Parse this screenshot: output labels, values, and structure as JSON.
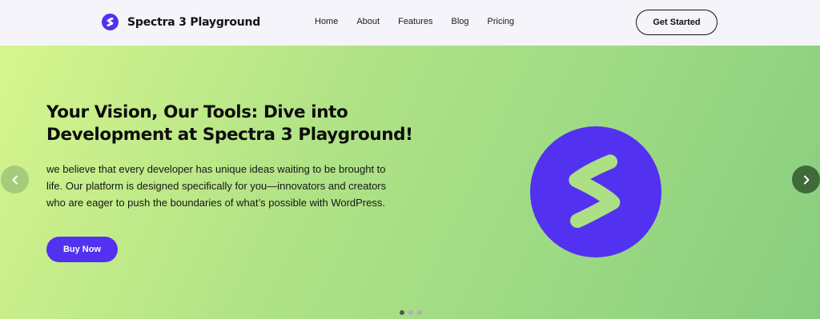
{
  "header": {
    "site_title": "Spectra 3 Playground",
    "nav": [
      {
        "label": "Home"
      },
      {
        "label": "About"
      },
      {
        "label": "Features"
      },
      {
        "label": "Blog"
      },
      {
        "label": "Pricing"
      }
    ],
    "cta_label": "Get Started",
    "logo_icon": "spectra-logo-icon"
  },
  "hero": {
    "headline": "Your Vision, Our Tools: Dive into Development at Spectra 3 Playground!",
    "description": "we believe that every developer has unique ideas waiting to be brought to life. Our platform is designed specifically for you—innovators and creators who are eager to push the boundaries of what’s possible with WordPress.",
    "button_label": "Buy Now",
    "image_icon": "spectra-logo-icon",
    "prev_icon": "chevron-left-icon",
    "next_icon": "chevron-right-icon",
    "slides_total": 3,
    "active_slide": 1
  },
  "colors": {
    "brand": "#5331f0",
    "header_bg": "#f5f4fb",
    "hero_gradient_start": "#d6f58e",
    "hero_gradient_end": "#88cd7f",
    "next_arrow_bg": "#3f6a3a",
    "active_dot": "#555555",
    "inactive_dot": "#b0b0b0"
  }
}
